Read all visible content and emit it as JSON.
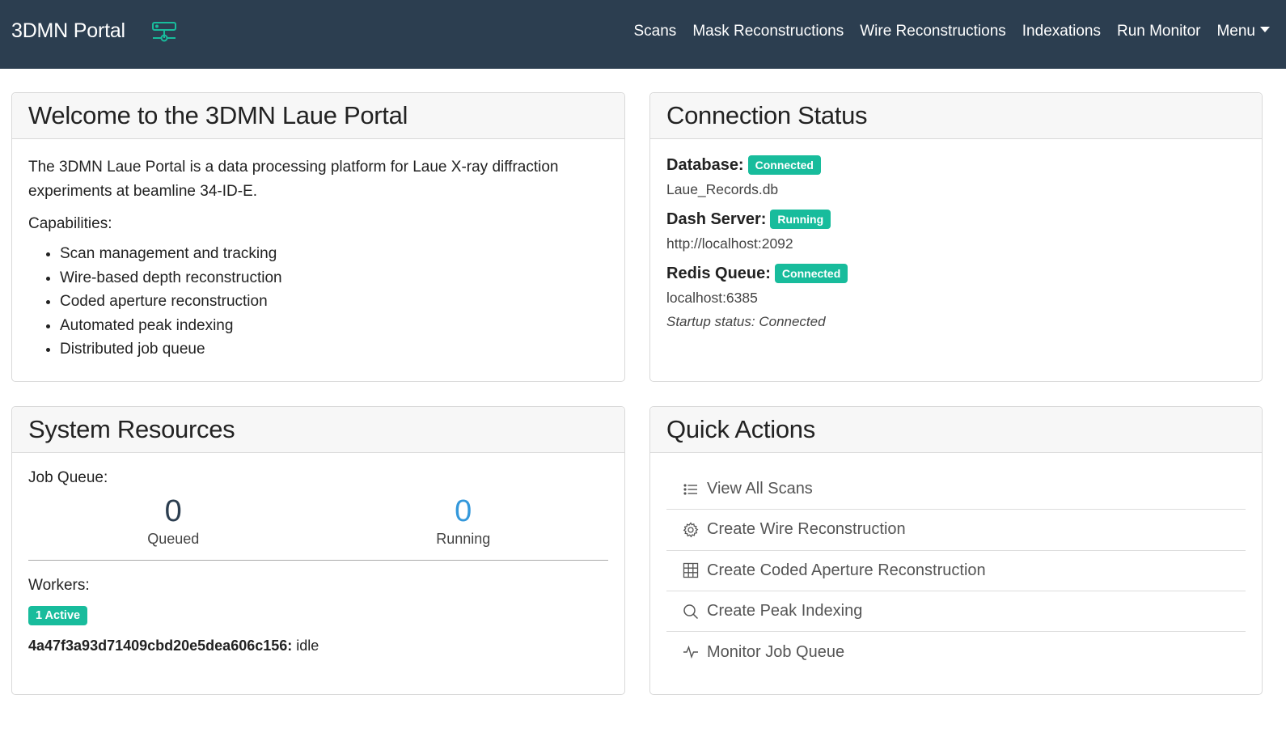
{
  "navbar": {
    "brand": "3DMN Portal",
    "brand_icon": "server-network-icon",
    "links": [
      "Scans",
      "Mask Reconstructions",
      "Wire Reconstructions",
      "Indexations",
      "Run Monitor"
    ],
    "menu_label": "Menu"
  },
  "welcome": {
    "title": "Welcome to the 3DMN Laue Portal",
    "intro": "The 3DMN Laue Portal is a data processing platform for Laue X-ray diffraction experiments at beamline 34-ID-E.",
    "capabilities_label": "Capabilities:",
    "capabilities": [
      "Scan management and tracking",
      "Wire-based depth reconstruction",
      "Coded aperture reconstruction",
      "Automated peak indexing",
      "Distributed job queue"
    ]
  },
  "connection": {
    "title": "Connection Status",
    "database": {
      "label": "Database:",
      "badge": "Connected",
      "value": "Laue_Records.db"
    },
    "dash": {
      "label": "Dash Server:",
      "badge": "Running",
      "value": "http://localhost:2092"
    },
    "redis": {
      "label": "Redis Queue:",
      "badge": "Connected",
      "value": "localhost:6385",
      "startup": "Startup status: Connected"
    }
  },
  "resources": {
    "title": "System Resources",
    "job_queue_label": "Job Queue:",
    "queued_count": "0",
    "queued_label": "Queued",
    "running_count": "0",
    "running_label": "Running",
    "workers_label": "Workers:",
    "workers_badge": "1 Active",
    "worker_id": "4a47f3a93d71409cbd20e5dea606c156:",
    "worker_state": " idle"
  },
  "quick_actions": {
    "title": "Quick Actions",
    "items": [
      {
        "label": "View All Scans",
        "icon": "list-icon"
      },
      {
        "label": "Create Wire Reconstruction",
        "icon": "gear-icon"
      },
      {
        "label": "Create Coded Aperture Reconstruction",
        "icon": "grid-icon"
      },
      {
        "label": "Create Peak Indexing",
        "icon": "search-icon"
      },
      {
        "label": "Monitor Job Queue",
        "icon": "activity-icon"
      }
    ]
  },
  "colors": {
    "navbar": "#2c3e50",
    "success": "#18bc9c",
    "info": "#3498db",
    "brand_icon": "#18bc9c"
  }
}
